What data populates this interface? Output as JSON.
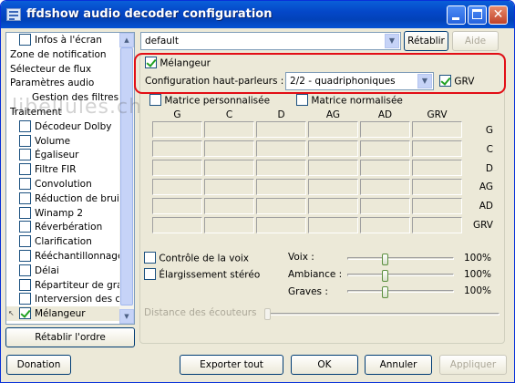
{
  "window": {
    "title": "ffdshow audio decoder configuration"
  },
  "sidebar": {
    "items": [
      {
        "label": "Infos à l'écran",
        "checkbox": true,
        "checked": false
      },
      {
        "label": "Zone de notification",
        "checkbox": false
      },
      {
        "label": "Sélecteur de flux",
        "checkbox": false
      },
      {
        "label": "Paramètres audio",
        "checkbox": false
      },
      {
        "label": "Gestion des filtres",
        "checkbox": false
      },
      {
        "label": "Traitement",
        "checkbox": false
      },
      {
        "label": "Décodeur Dolby",
        "checkbox": true,
        "checked": false
      },
      {
        "label": "Volume",
        "checkbox": true,
        "checked": false
      },
      {
        "label": "Égaliseur",
        "checkbox": true,
        "checked": false
      },
      {
        "label": "Filtre FIR",
        "checkbox": true,
        "checked": false
      },
      {
        "label": "Convolution",
        "checkbox": true,
        "checked": false
      },
      {
        "label": "Réduction de bruit",
        "checkbox": true,
        "checked": false
      },
      {
        "label": "Winamp 2",
        "checkbox": true,
        "checked": false
      },
      {
        "label": "Réverbération",
        "checkbox": true,
        "checked": false
      },
      {
        "label": "Clarification",
        "checkbox": true,
        "checked": false
      },
      {
        "label": "Rééchantillonnage",
        "checkbox": true,
        "checked": false
      },
      {
        "label": "Délai",
        "checkbox": true,
        "checked": false
      },
      {
        "label": "Répartiteur de grav",
        "checkbox": true,
        "checked": false
      },
      {
        "label": "Interversion des car",
        "checkbox": true,
        "checked": false
      },
      {
        "label": "Mélangeur",
        "checkbox": true,
        "checked": true,
        "selected": true
      }
    ],
    "reset_order_label": "Rétablir l'ordre"
  },
  "watermark": "libellules.ch",
  "preset": {
    "value": "default",
    "restore_label": "Rétablir",
    "help_label": "Aide"
  },
  "mixer": {
    "enable_label": "Mélangeur",
    "enabled": true,
    "speaker_config_label": "Configuration haut-parleurs :",
    "speaker_config_value": "2/2 - quadriphoniques",
    "lfe_label": "GRV",
    "lfe_checked": true,
    "custom_matrix_label": "Matrice personnalisée",
    "normalize_matrix_label": "Matrice normalisée",
    "columns": [
      "G",
      "C",
      "D",
      "AG",
      "AD",
      "GRV"
    ],
    "rows": [
      "G",
      "C",
      "D",
      "AG",
      "AD",
      "GRV"
    ],
    "voice_control_label": "Contrôle de la voix",
    "stereo_widen_label": "Élargissement stéréo",
    "voice_label": "Voix :",
    "voice_value": "100%",
    "voice_level": 1.0,
    "ambience_label": "Ambiance :",
    "ambience_value": "100%",
    "ambience_level": 1.0,
    "bass_label": "Graves :",
    "bass_value": "100%",
    "bass_level": 1.0,
    "headphone_distance_label": "Distance des écouteurs"
  },
  "footer": {
    "donate_label": "Donation",
    "export_label": "Exporter tout",
    "ok_label": "OK",
    "cancel_label": "Annuler",
    "apply_label": "Appliquer"
  }
}
